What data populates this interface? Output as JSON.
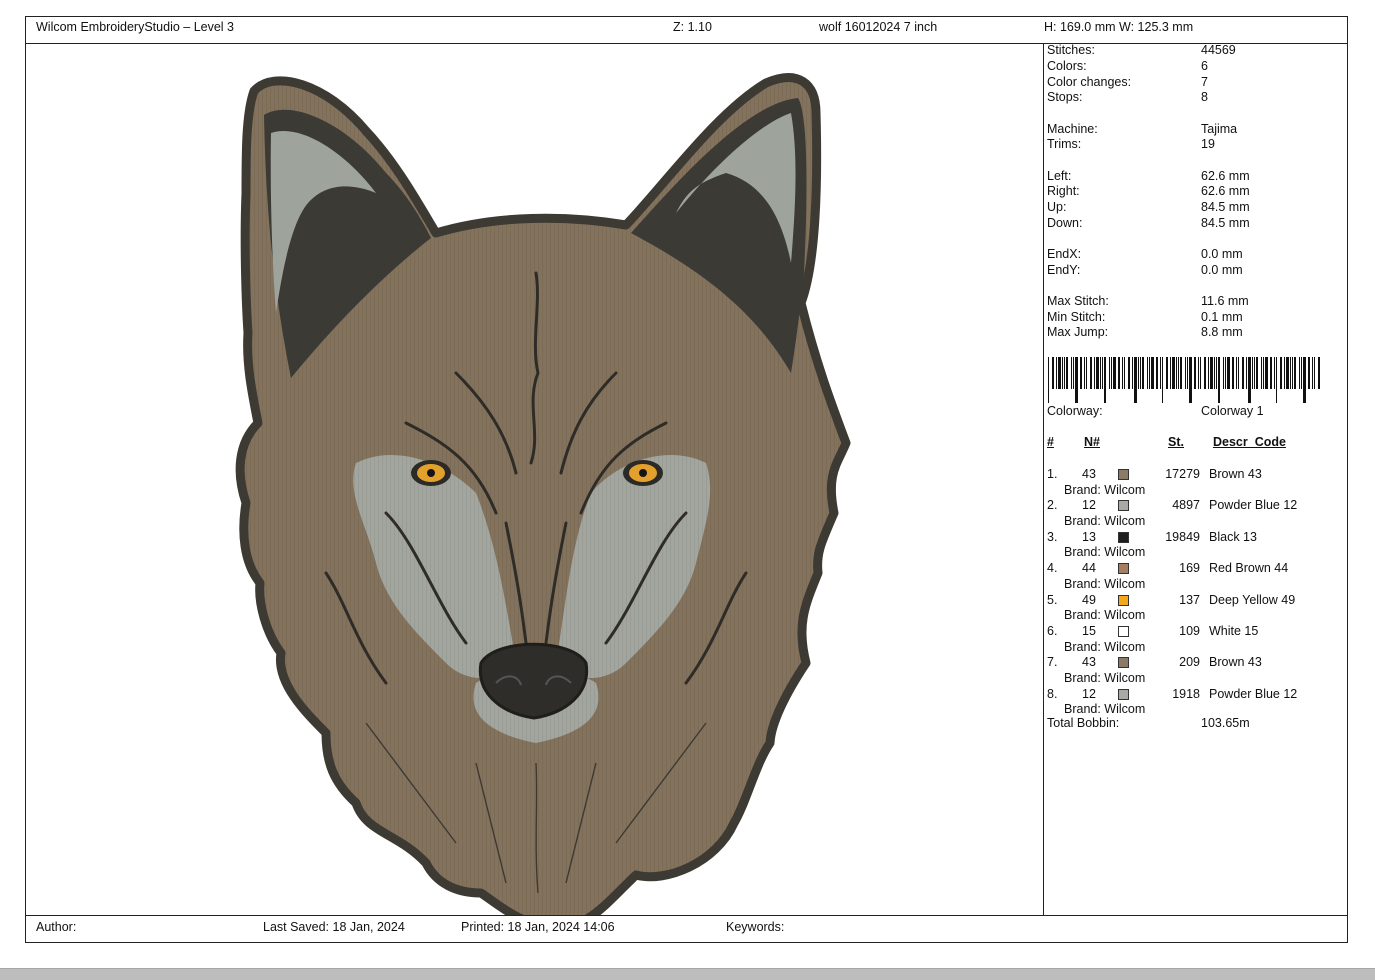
{
  "header": {
    "app_title": "Wilcom EmbroideryStudio – Level 3",
    "zoom": "Z: 1.10",
    "design_name": "wolf 16012024 7 inch",
    "dimensions": "H: 169.0 mm   W: 125.3 mm"
  },
  "footer": {
    "author": "Author:",
    "last_saved": "Last Saved: 18 Jan, 2024",
    "printed": "Printed: 18 Jan, 2024 14:06",
    "keywords": "Keywords:"
  },
  "stats": {
    "stitches": {
      "label": "Stitches:",
      "value": "44569"
    },
    "colors": {
      "label": "Colors:",
      "value": "6"
    },
    "color_changes": {
      "label": "Color changes:",
      "value": "7"
    },
    "stops": {
      "label": "Stops:",
      "value": "8"
    },
    "machine": {
      "label": "Machine:",
      "value": "Tajima"
    },
    "trims": {
      "label": "Trims:",
      "value": "19"
    },
    "left": {
      "label": "Left:",
      "value": "62.6 mm"
    },
    "right": {
      "label": "Right:",
      "value": "62.6 mm"
    },
    "up": {
      "label": "Up:",
      "value": "84.5 mm"
    },
    "down": {
      "label": "Down:",
      "value": "84.5 mm"
    },
    "endx": {
      "label": "EndX:",
      "value": "0.0 mm"
    },
    "endy": {
      "label": "EndY:",
      "value": "0.0 mm"
    },
    "max_stitch": {
      "label": "Max Stitch:",
      "value": "11.6 mm"
    },
    "min_stitch": {
      "label": "Min Stitch:",
      "value": "0.1 mm"
    },
    "max_jump": {
      "label": "Max Jump:",
      "value": "8.8 mm"
    },
    "colorway": {
      "label": "Colorway:",
      "value": "Colorway 1"
    }
  },
  "color_table": {
    "headers": {
      "num": "#",
      "n": "N#",
      "st": "St.",
      "descr": "Descr_Code"
    },
    "rows": [
      {
        "idx": "1.",
        "n": "43",
        "color": "#8b7a66",
        "stitches": "17279",
        "descr": "Brown 43",
        "brand": "Brand: Wilcom"
      },
      {
        "idx": "2.",
        "n": "12",
        "color": "#a8aaa6",
        "stitches": "4897",
        "descr": "Powder Blue 12",
        "brand": "Brand: Wilcom"
      },
      {
        "idx": "3.",
        "n": "13",
        "color": "#1f1f1f",
        "stitches": "19849",
        "descr": "Black 13",
        "brand": "Brand: Wilcom"
      },
      {
        "idx": "4.",
        "n": "44",
        "color": "#a57e62",
        "stitches": "169",
        "descr": "Red Brown 44",
        "brand": "Brand: Wilcom"
      },
      {
        "idx": "5.",
        "n": "49",
        "color": "#f2a81a",
        "stitches": "137",
        "descr": "Deep Yellow 49",
        "brand": "Brand: Wilcom"
      },
      {
        "idx": "6.",
        "n": "15",
        "color": "#ffffff",
        "stitches": "109",
        "descr": "White 15",
        "brand": "Brand: Wilcom"
      },
      {
        "idx": "7.",
        "n": "43",
        "color": "#8b7a66",
        "stitches": "209",
        "descr": "Brown 43",
        "brand": "Brand: Wilcom"
      },
      {
        "idx": "8.",
        "n": "12",
        "color": "#a8aaa6",
        "stitches": "1918",
        "descr": "Powder Blue 12",
        "brand": "Brand: Wilcom"
      }
    ],
    "total_bobbin": {
      "label": "Total Bobbin:",
      "value": "103.65m"
    }
  }
}
